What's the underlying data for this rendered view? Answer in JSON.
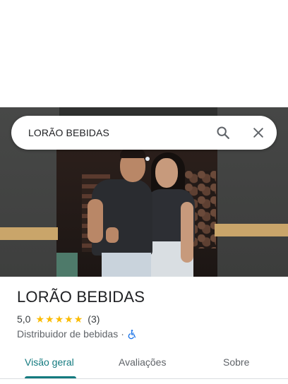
{
  "search": {
    "query": "LORÃO BEBIDAS",
    "search_icon": "search-icon",
    "close_icon": "close-icon"
  },
  "hero": {
    "photo": "storefront-photo"
  },
  "place": {
    "name": "LORÃO BEBIDAS",
    "rating": "5,0",
    "stars": [
      "★",
      "★",
      "★",
      "★",
      "★"
    ],
    "star_color": "#fbbc04",
    "review_count": "(3)",
    "category": "Distribuidor de bebidas",
    "separator": "·",
    "accessibility_icon": "wheelchair-icon",
    "accessibility_color": "#1a73e8"
  },
  "tabs": {
    "items": [
      {
        "label": "Visão geral",
        "active": true
      },
      {
        "label": "Avaliações",
        "active": false
      },
      {
        "label": "Sobre",
        "active": false
      }
    ],
    "accent_color": "#137a7f"
  }
}
